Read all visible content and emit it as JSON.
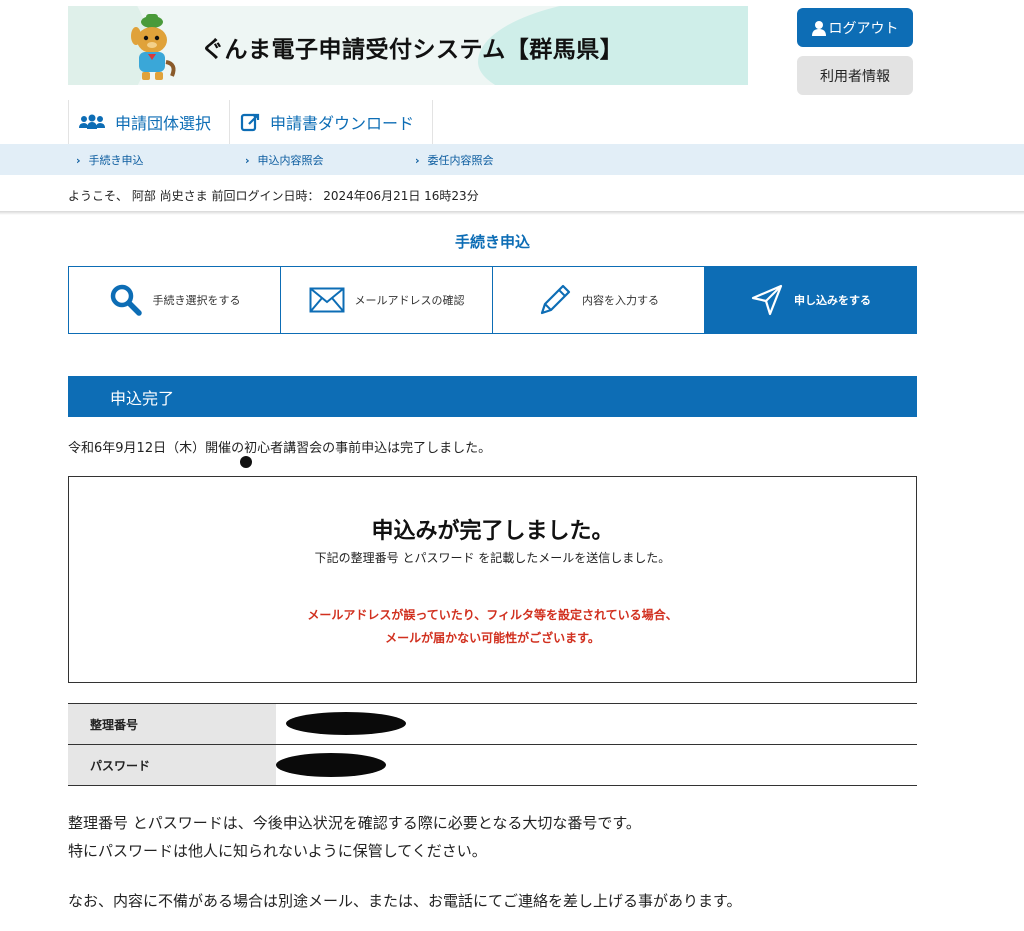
{
  "header": {
    "site_title": "ぐんま電子申請受付システム【群馬県】",
    "logout_label": "ログアウト",
    "user_info_label": "利用者情報"
  },
  "topnav": {
    "items": [
      {
        "label": "申請団体選択",
        "icon": "group-icon"
      },
      {
        "label": "申請書ダウンロード",
        "icon": "download-doc-icon"
      }
    ]
  },
  "subnav": {
    "links": [
      {
        "label": "手続き申込"
      },
      {
        "label": "申込内容照会"
      },
      {
        "label": "委任内容照会"
      }
    ]
  },
  "welcome": "ようこそ、 阿部  尚史さま  前回ログイン日時： 2024年06月21日 16時23分",
  "page": {
    "section_title": "手続き申込",
    "steps": [
      {
        "label": "手続き選択をする",
        "icon": "search-icon",
        "active": false
      },
      {
        "label": "メールアドレスの確認",
        "icon": "mail-icon",
        "active": false
      },
      {
        "label": "内容を入力する",
        "icon": "pencil-icon",
        "active": false
      },
      {
        "label": "申し込みをする",
        "icon": "send-icon",
        "active": true
      }
    ],
    "bar_title": "申込完了",
    "notice": "令和6年9月12日（木）開催の初心者講習会の事前申込は完了しました。",
    "done": {
      "heading": "申込みが完了しました。",
      "sub": "下記の整理番号 とパスワード を記載したメールを送信しました。",
      "warning_line1": "メールアドレスが誤っていたり、フィルタ等を設定されている場合、",
      "warning_line2": "メールが届かない可能性がございます。"
    },
    "table": {
      "rows": [
        {
          "label": "整理番号"
        },
        {
          "label": "パスワード"
        }
      ]
    },
    "para1_line1": "整理番号 とパスワードは、今後申込状況を確認する際に必要となる大切な番号です。",
    "para1_line2": "特にパスワードは他人に知られないように保管してください。",
    "para2": "なお、内容に不備がある場合は別途メール、または、お電話にてご連絡を差し上げる事があります。"
  },
  "colors": {
    "primary": "#0d6db5",
    "warning": "#d1301f",
    "subnav_bg": "#e2eef7"
  }
}
